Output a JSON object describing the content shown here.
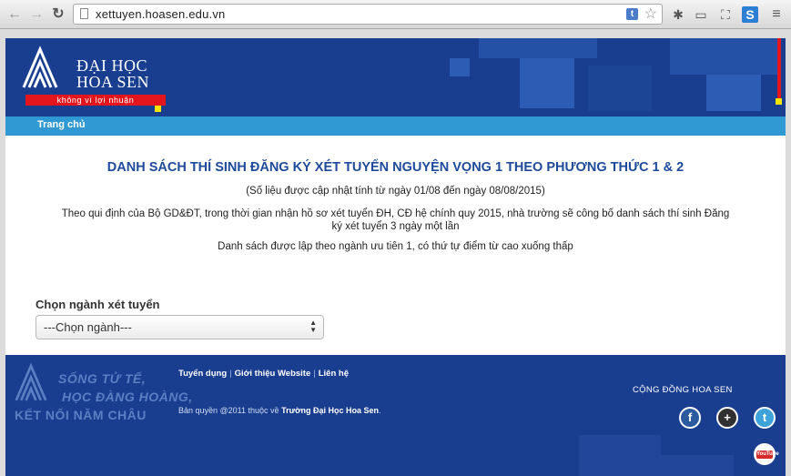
{
  "browser": {
    "url": "xettuyen.hoasen.edu.vn",
    "ext_badge": "t"
  },
  "header": {
    "logo_line1": "ĐẠI HỌC",
    "logo_line2": "HOA SEN",
    "slogan": "không vì lợi nhuận",
    "brand_color": "#1a3e8f",
    "accent_red": "#e3161e"
  },
  "menu": {
    "home": "Trang chủ"
  },
  "content": {
    "title": "DANH SÁCH THÍ SINH ĐĂNG KÝ XÉT TUYỂN NGUYỆN VỌNG 1 THEO PHƯƠNG THỨC 1 & 2",
    "update_note": "(Số liệu được cập nhật tính từ ngày 01/08 đến ngày 08/08/2015)",
    "policy": "Theo qui định của Bộ GD&ĐT, trong thời gian nhận hồ sơ xét tuyển ĐH, CĐ hệ chính quy 2015, nhà trường sẽ công bố danh sách thí sinh Đăng ký xét tuyển 3 ngày một lần",
    "sort_note": "Danh sách được lập theo ngành ưu tiên 1, có thứ tự điểm từ cao xuống thấp",
    "select_label": "Chọn ngành xét tuyển",
    "select_value": "---Chọn ngành---"
  },
  "footer": {
    "watermark_1": "SỐNG TỬ TẾ,",
    "watermark_2": "HỌC ĐÀNG HOÀNG,",
    "watermark_3": "KẾT NỐI NĂM CHÂU",
    "link_1": "Tuyển dụng",
    "link_2": "Giới thiệu Website",
    "link_3": "Liên hệ",
    "copyright_prefix": "Bản quyền @2011 thuộc về ",
    "copyright_owner": "Trường Đại Học Hoa Sen",
    "copyright_suffix": ".",
    "community": "CỘNG ĐỒNG HOA SEN",
    "youtube_label": "YouTube"
  }
}
